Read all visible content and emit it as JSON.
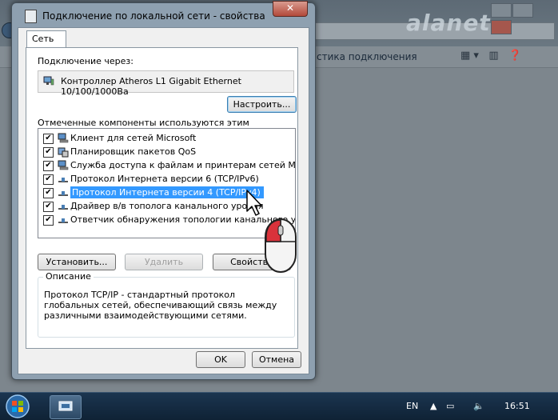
{
  "background": {
    "breadcrumb_tail": "стика подключения",
    "logo": "alanet"
  },
  "dialog": {
    "title": "Подключение по локальной сети - свойства",
    "close_label": "✕",
    "tab": "Сеть",
    "connect_through_label": "Подключение через:",
    "adapter_name": "Контроллер Atheros L1 Gigabit Ethernet 10/100/1000Ba",
    "configure_button": "Настроить...",
    "components_label": "Отмеченные компоненты используются этим подключением:",
    "components": [
      {
        "label": "Клиент для сетей Microsoft",
        "checked": true,
        "icon": "network-client-icon"
      },
      {
        "label": "Планировщик пакетов QoS",
        "checked": true,
        "icon": "service-icon"
      },
      {
        "label": "Служба доступа к файлам и принтерам сетей Micro...",
        "checked": true,
        "icon": "network-client-icon"
      },
      {
        "label": "Протокол Интернета версии 6 (TCP/IPv6)",
        "checked": true,
        "icon": "protocol-icon"
      },
      {
        "label": "Протокол Интернета версии 4 (TCP/IPv4)",
        "checked": true,
        "icon": "protocol-icon",
        "selected": true
      },
      {
        "label": "Драйвер в/в тополога канального уровня",
        "checked": true,
        "icon": "protocol-icon"
      },
      {
        "label": "Ответчик обнаружения топологии канального ур",
        "checked": true,
        "icon": "protocol-icon"
      }
    ],
    "install_button": "Установить...",
    "remove_button": "Удалить",
    "properties_button": "Свойства",
    "description_title": "Описание",
    "description_text": "Протокол TCP/IP - стандартный протокол глобальных сетей, обеспечивающий связь между различными взаимодействующими сетями.",
    "ok_button": "OK",
    "cancel_button": "Отмена",
    "checkmark": "✔"
  },
  "taskbar": {
    "language": "EN",
    "clock": "16:51"
  },
  "colors": {
    "selection": "#3399ff",
    "taskbar": "#0f2235"
  }
}
